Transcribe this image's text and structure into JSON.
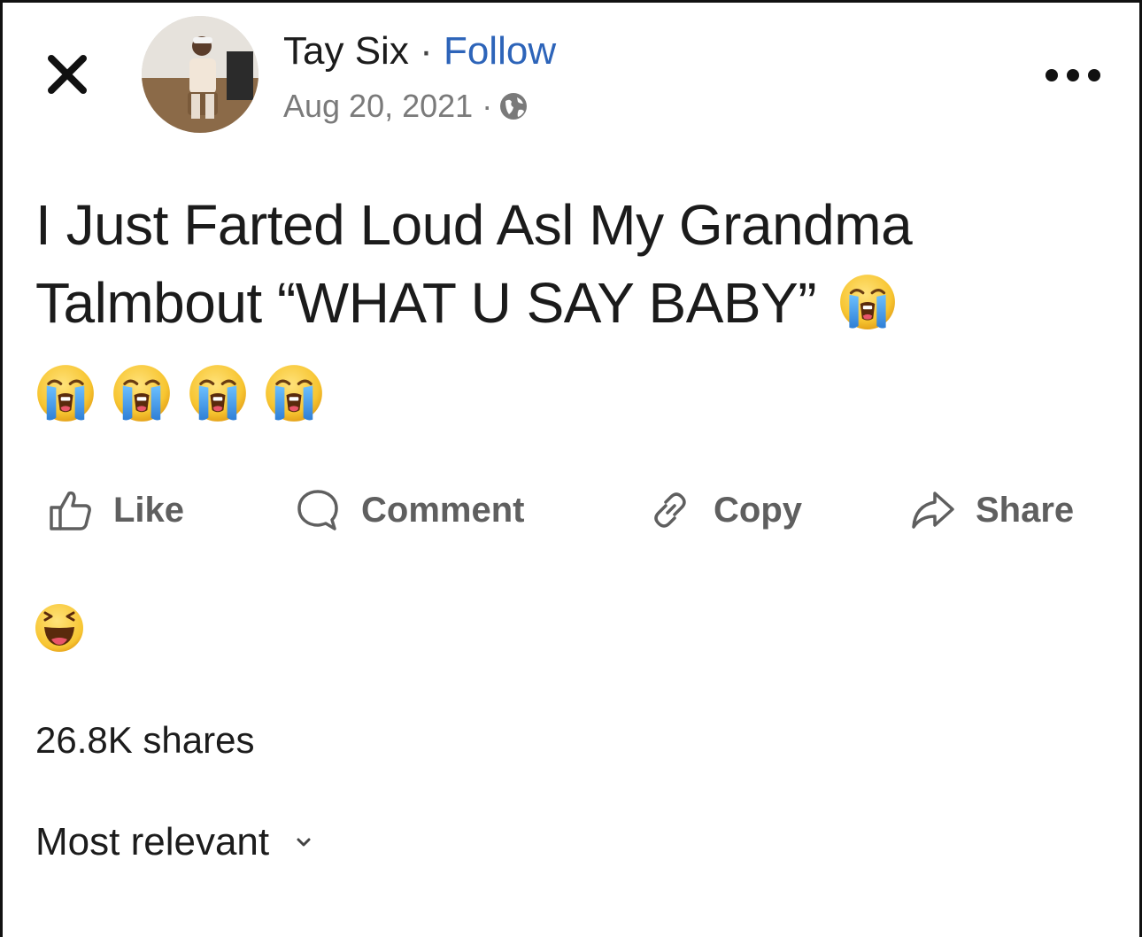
{
  "post": {
    "author": "Tay Six",
    "separator": "·",
    "follow_label": "Follow",
    "date": "Aug 20, 2021 ·",
    "text_line1": "I Just Farted Loud Asl My Grandma",
    "text_line2": "Talmbout “WHAT U SAY BABY”",
    "emojis": [
      "loudly-crying-face",
      "loudly-crying-face",
      "loudly-crying-face",
      "loudly-crying-face",
      "loudly-crying-face"
    ]
  },
  "actions": {
    "like": "Like",
    "comment": "Comment",
    "copy": "Copy",
    "share": "Share"
  },
  "reactions": {
    "icon": "haha-reaction-icon"
  },
  "stats": {
    "shares": "26.8K shares"
  },
  "comments": {
    "sort_label": "Most relevant"
  },
  "colors": {
    "follow": "#2d64b9",
    "action_text": "#5f5f5f",
    "meta_text": "#7a7a7a",
    "emoji_yellow": "#f7c531",
    "tears_blue": "#4aa3e8"
  }
}
